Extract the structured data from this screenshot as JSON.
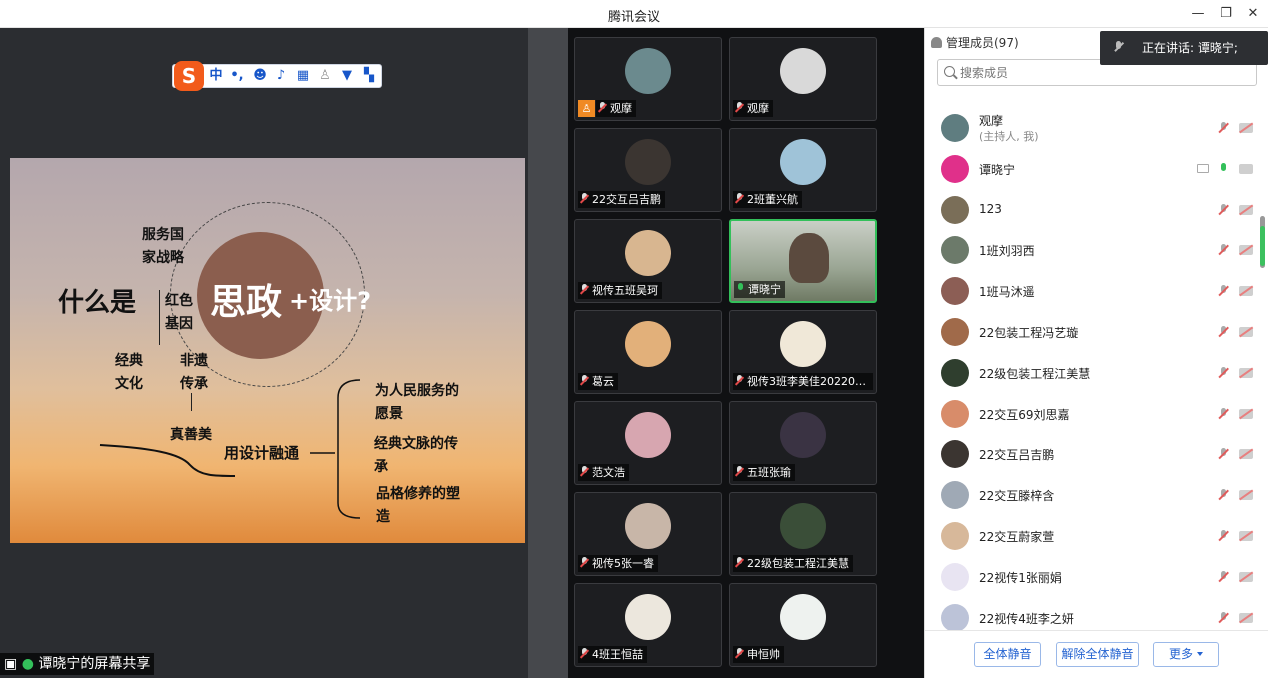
{
  "window": {
    "title": "腾讯会议",
    "minimize_glyph": "—",
    "restore_glyph": "❐",
    "close_glyph": "✕"
  },
  "ime_toolbar": {
    "logo": "S",
    "mode": "中",
    "punct": "•,",
    "icons": [
      "emoji-icon",
      "mic-icon",
      "keyboard-icon",
      "user-icon",
      "shirt-icon",
      "grid-icon"
    ]
  },
  "slide": {
    "what_is": "什么是",
    "sizheng": "思政",
    "plus_design": "+设计?",
    "serve_nation_1": "服务国",
    "serve_nation_2": "家战略",
    "red_gene_1": "红色",
    "red_gene_2": "基因",
    "classic_culture_1": "经典",
    "classic_culture_2": "文化",
    "heritage_1": "非遗",
    "heritage_2": "传承",
    "truth_good_beauty": "真善美",
    "design_integration": "用设计融通",
    "vision_1_a": "为人民服务的",
    "vision_1_b": "愿景",
    "vision_2_a": "经典文脉的传",
    "vision_2_b": "承",
    "vision_3_a": "品格修养的塑",
    "vision_3_b": "造"
  },
  "share_label": "谭晓宁的屏幕共享",
  "tiles": [
    {
      "name": "观摩",
      "color": "#6b8a8e",
      "host": true
    },
    {
      "name": "观摩",
      "color": "#d9d9d9"
    },
    {
      "name": "22交互吕吉鹏",
      "color": "#3b3531"
    },
    {
      "name": "2班董兴航",
      "color": "#9fc3d8"
    },
    {
      "name": "视传五班吴珂",
      "color": "#d8b690"
    },
    {
      "name": "谭晓宁",
      "color": "#6e7a6a",
      "active": true
    },
    {
      "name": "葛云",
      "color": "#e2b07a"
    },
    {
      "name": "视传3班李美佳2022010...",
      "color": "#f0e8d8"
    },
    {
      "name": "范文浩",
      "color": "#d7a6b0"
    },
    {
      "name": "五班张瑜",
      "color": "#3a3343"
    },
    {
      "name": "视传5张一睿",
      "color": "#c8b6a8"
    },
    {
      "name": "22级包装工程江美慧",
      "color": "#3a4e38"
    },
    {
      "name": "4班王恒喆",
      "color": "#ece7dd"
    },
    {
      "name": "申恒帅",
      "color": "#eef2ef"
    }
  ],
  "panel": {
    "header": "管理成员(97)",
    "search_placeholder": "搜索成员",
    "toast": "正在讲话: 谭晓宁;",
    "members": [
      {
        "name": "观摩",
        "sub": "(主持人, 我)",
        "color": "#5f7d80"
      },
      {
        "name": "谭晓宁",
        "color": "#e0308a",
        "speaking": true
      },
      {
        "name": "123",
        "color": "#7a6e58"
      },
      {
        "name": "1班刘羽西",
        "color": "#6c7a6a"
      },
      {
        "name": "1班马沐遥",
        "color": "#8c5e55"
      },
      {
        "name": "22包装工程冯艺璇",
        "color": "#a06a4a"
      },
      {
        "name": "22级包装工程江美慧",
        "color": "#2f3e2e"
      },
      {
        "name": "22交互69刘思嘉",
        "color": "#d88c6a"
      },
      {
        "name": "22交互吕吉鹏",
        "color": "#3b3531"
      },
      {
        "name": "22交互滕梓含",
        "color": "#9fa9b5"
      },
      {
        "name": "22交互蔚家萱",
        "color": "#d7b89a"
      },
      {
        "name": "22视传1张丽娟",
        "color": "#e8e4f2"
      },
      {
        "name": "22视传4班李之妍",
        "color": "#bcc3d8"
      }
    ],
    "mute_all": "全体静音",
    "unmute_all": "解除全体静音",
    "more": "更多"
  }
}
